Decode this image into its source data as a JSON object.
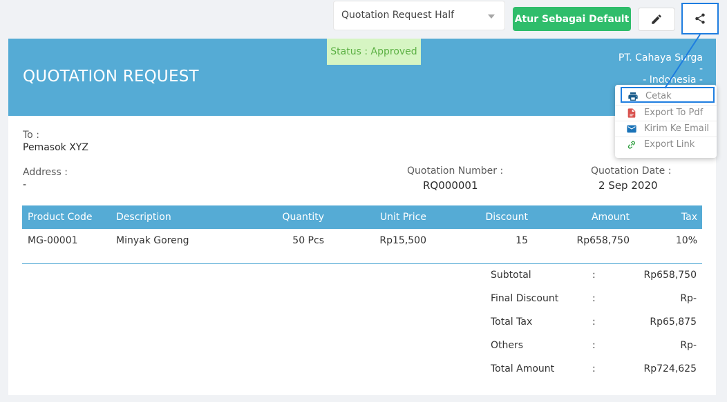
{
  "toolbar": {
    "template_select": "Quotation Request Half",
    "set_default_label": "Atur Sebagai Default"
  },
  "header": {
    "title": "QUOTATION REQUEST",
    "status": "Status : Approved",
    "company_name": "PT. Cahaya Surga",
    "company_line2": "-",
    "company_line3": "- Indonesia -"
  },
  "info": {
    "to_label": "To :",
    "to_value": "Pemasok XYZ",
    "address_label": "Address :",
    "address_value": "-",
    "number_label": "Quotation Number :",
    "number_value": "RQ000001",
    "date_label": "Quotation Date :",
    "date_value": "2 Sep 2020"
  },
  "table": {
    "headers": [
      "Product Code",
      "Description",
      "Quantity",
      "Unit Price",
      "Discount",
      "Amount",
      "Tax"
    ],
    "rows": [
      [
        "MG-00001",
        "Minyak Goreng",
        "50 Pcs",
        "Rp15,500",
        "15",
        "Rp658,750",
        "10%"
      ]
    ]
  },
  "totals": [
    {
      "label": "Subtotal",
      "sep": ":",
      "value": "Rp658,750"
    },
    {
      "label": "Final Discount",
      "sep": ":",
      "value": "Rp-"
    },
    {
      "label": "Total Tax",
      "sep": ":",
      "value": "Rp65,875"
    },
    {
      "label": "Others",
      "sep": ":",
      "value": "Rp-"
    },
    {
      "label": "Total Amount",
      "sep": ":",
      "value": "Rp724,625"
    }
  ],
  "share_menu": {
    "items": [
      {
        "label": "Cetak",
        "icon": "printer-icon"
      },
      {
        "label": "Export To Pdf",
        "icon": "pdf-icon"
      },
      {
        "label": "Kirim Ke Email",
        "icon": "email-icon"
      },
      {
        "label": "Export Link",
        "icon": "link-icon"
      }
    ]
  },
  "colors": {
    "header_bg": "#55abd5",
    "accent_green": "#2fbd6b",
    "highlight_blue": "#1e7de0",
    "status_bg": "#d6f5c3",
    "status_text": "#5bb043"
  }
}
